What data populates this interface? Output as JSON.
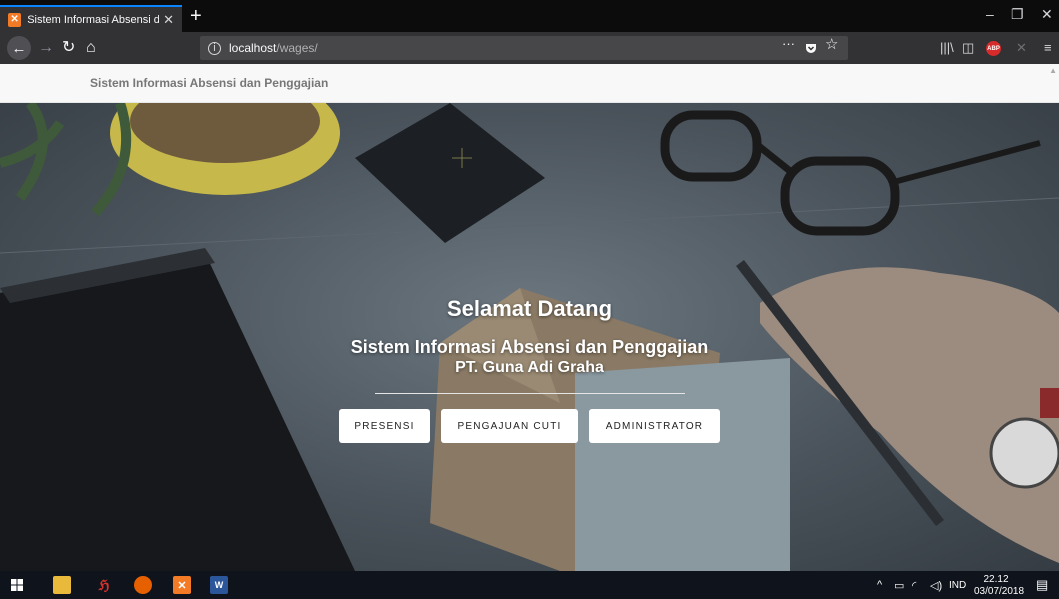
{
  "browser": {
    "tab_title": "Sistem Informasi Absensi dan P",
    "tab_close": "✕",
    "new_tab": "+",
    "url_host": "localhost",
    "url_path": "/wages/",
    "page_actions": "···"
  },
  "site": {
    "brand": "Sistem Informasi Absensi dan Penggajian"
  },
  "hero": {
    "title": "Selamat Datang",
    "subtitle": "Sistem Informasi Absensi dan Penggajian",
    "organization": "PT. Guna Adi Graha",
    "buttons": {
      "presensi": "PRESENSI",
      "pengajuan_cuti": "PENGAJUAN CUTI",
      "administrator": "ADMINISTRATOR"
    }
  },
  "taskbar": {
    "language": "IND",
    "time": "22.12",
    "date": "03/07/2018"
  },
  "colors": {
    "tab_accent": "#0a84ff",
    "firefox_chrome": "#323234",
    "hero_overlay": "#4a535b",
    "button_bg": "#ffffff"
  }
}
